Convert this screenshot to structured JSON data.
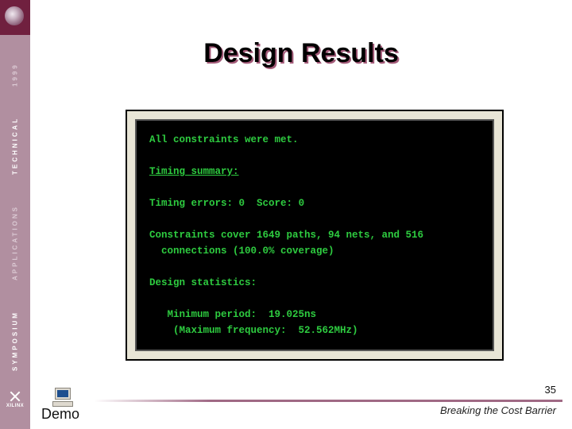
{
  "sidebar": {
    "line1": "SYMPOSIUM",
    "line2": "APPLICATIONS",
    "line3": "TECHNICAL",
    "year": "1999",
    "vendor": "XILINX"
  },
  "title": "Design Results",
  "terminal": {
    "line1": "All constraints were met.",
    "line2_label": "Timing summary:",
    "line3_a": "Timing errors: ",
    "line3_b": "0",
    "line3_c": "  Score: ",
    "line3_d": "0",
    "line4": "Constraints cover 1649 paths, 94 nets, and 516",
    "line5": "  connections (100.0% coverage)",
    "line6": "Design statistics:",
    "line7": "   Minimum period:  19.025ns",
    "line8": "    (Maximum frequency:  52.562MHz)"
  },
  "footer": {
    "demo_label": "Demo",
    "page_number": "35",
    "tagline": "Breaking the Cost Barrier"
  }
}
